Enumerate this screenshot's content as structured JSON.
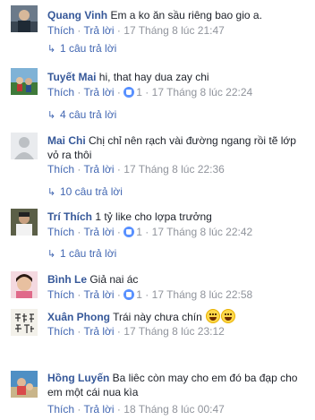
{
  "labels": {
    "like": "Thích",
    "reply": "Trả lời",
    "sep": "·"
  },
  "comments": [
    {
      "author": "Quang Vinh",
      "text": "Em a ko ăn sầu riêng bao gio a.",
      "likes": "",
      "date": "17 Tháng 8 lúc 21:47",
      "replies": "1 câu trả lời"
    },
    {
      "author": "Tuyết Mai",
      "text": "hi, that hay dua zay chi",
      "likes": "1",
      "date": "17 Tháng 8 lúc 22:24",
      "replies": "4 câu trả lời"
    },
    {
      "author": "Mai Chi",
      "text": "Chị chỉ nên rạch vài đường ngang rồi tẽ lớp vỏ ra thôi",
      "likes": "",
      "date": "17 Tháng 8 lúc 22:36",
      "replies": "10 câu trả lời"
    },
    {
      "author": "Trí Thích",
      "text": "1 tỷ like cho lợpa trưởng",
      "likes": "1",
      "date": "17 Tháng 8 lúc 22:42",
      "replies": "1 câu trả lời"
    },
    {
      "author": "Bình Le",
      "text": "Giả nai ác",
      "likes": "1",
      "date": "17 Tháng 8 lúc 22:58",
      "replies": ""
    },
    {
      "author": "Xuân Phong",
      "text": "Trái này chưa chín",
      "likes": "",
      "date": "17 Tháng 8 lúc 23:12",
      "replies": ""
    },
    {
      "author": "Hồng Luyến",
      "text": "Ba liêc còn may cho em đó ba đạp cho em một cái nua kìa",
      "likes": "",
      "date": "18 Tháng 8 lúc 00:47",
      "replies": ""
    }
  ],
  "colors": {
    "author": "#365899",
    "link": "#4267b2",
    "meta": "#90949c",
    "text": "#1d2129",
    "like_badge": "#5890ff"
  }
}
